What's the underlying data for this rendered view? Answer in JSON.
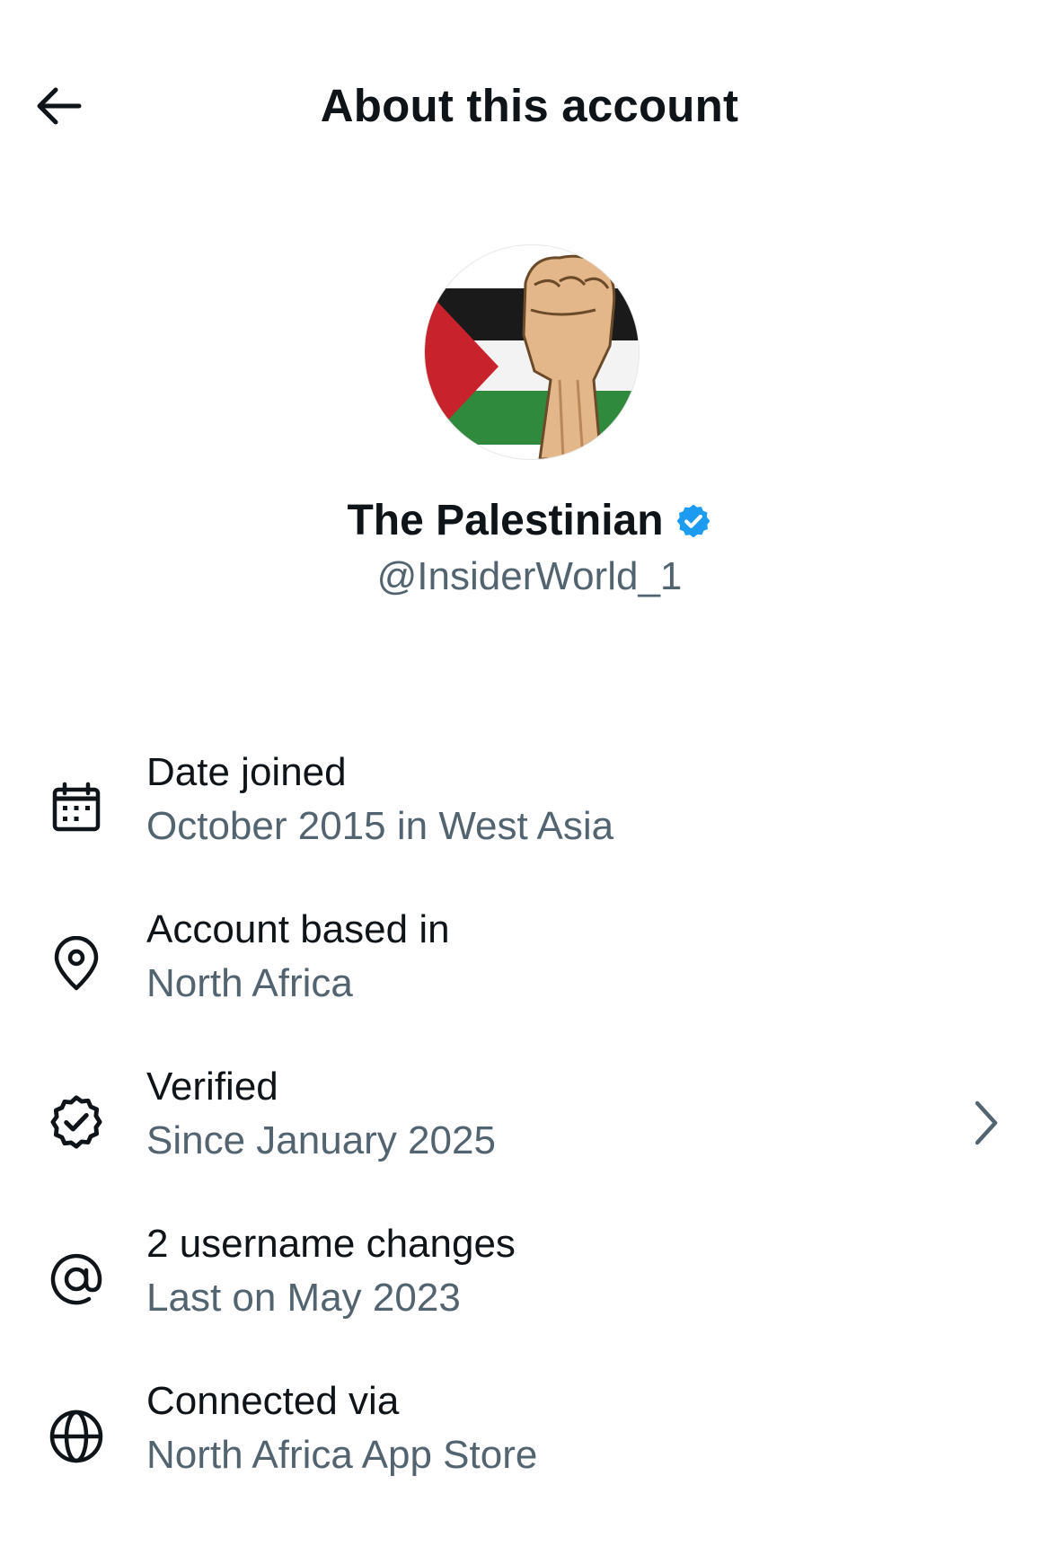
{
  "header": {
    "title": "About this account"
  },
  "profile": {
    "display_name": "The Palestinian",
    "handle": "@InsiderWorld_1",
    "verified": true,
    "verified_color": "#1d9bf0"
  },
  "info": [
    {
      "icon": "calendar-icon",
      "label": "Date joined",
      "value": "October 2015 in West Asia"
    },
    {
      "icon": "location-pin-icon",
      "label": "Account based in",
      "value": "North Africa"
    },
    {
      "icon": "verified-badge-icon",
      "label": "Verified",
      "value": "Since January 2025",
      "has_chevron": true
    },
    {
      "icon": "at-sign-icon",
      "label": "2 username changes",
      "value": "Last on May 2023"
    },
    {
      "icon": "globe-icon",
      "label": "Connected via",
      "value": "North Africa App Store"
    }
  ],
  "colors": {
    "text_primary": "#0f1419",
    "text_secondary": "#536471",
    "background": "#ffffff"
  }
}
